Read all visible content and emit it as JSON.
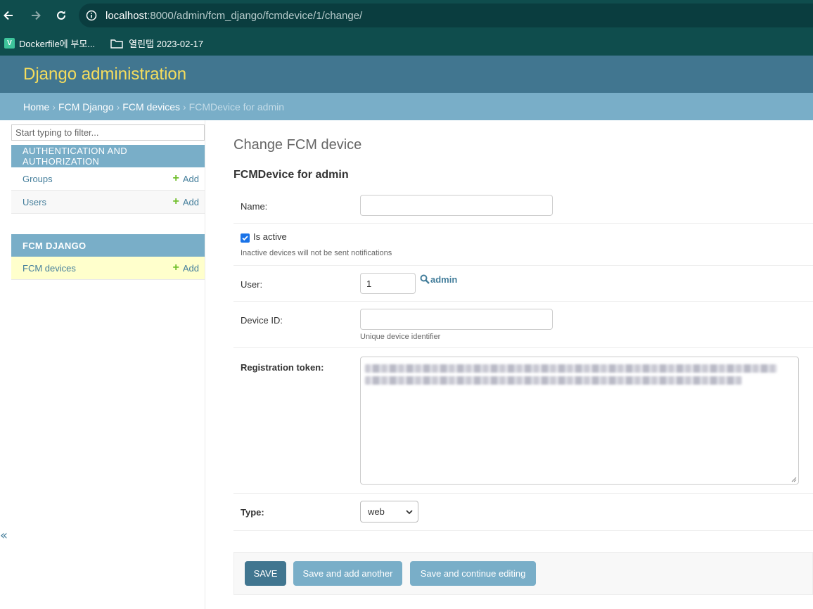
{
  "browser": {
    "url_host": "localhost",
    "url_path": ":8000/admin/fcm_django/fcmdevice/1/change/",
    "bookmarks": [
      {
        "label": "Dockerfile에 부모...",
        "icon": "v-site-icon"
      },
      {
        "label": "열린탭 2023-02-17",
        "icon": "folder-icon"
      }
    ]
  },
  "header": {
    "brand": "Django administration"
  },
  "breadcrumbs": {
    "items": [
      "Home",
      "FCM Django",
      "FCM devices"
    ],
    "separator": "›",
    "current": "FCMDevice for admin"
  },
  "sidebar": {
    "filter_placeholder": "Start typing to filter...",
    "modules": [
      {
        "caption": "AUTHENTICATION AND AUTHORIZATION",
        "models": [
          {
            "name": "Groups",
            "add": "Add"
          },
          {
            "name": "Users",
            "add": "Add"
          }
        ]
      },
      {
        "caption": "FCM DJANGO",
        "models": [
          {
            "name": "FCM devices",
            "add": "Add"
          }
        ]
      }
    ],
    "collapse_label": "«"
  },
  "content": {
    "page_title": "Change FCM device",
    "object_title": "FCMDevice for admin",
    "fields": {
      "name": {
        "label": "Name:",
        "value": ""
      },
      "is_active": {
        "label": "Is active",
        "checked": true,
        "help": "Inactive devices will not be sent notifications"
      },
      "user": {
        "label": "User:",
        "value": "1",
        "lookup_name": "admin"
      },
      "device_id": {
        "label": "Device ID:",
        "value": "",
        "help": "Unique device identifier"
      },
      "registration_token": {
        "label": "Registration token:"
      },
      "type": {
        "label": "Type:",
        "selected": "web"
      }
    },
    "buttons": {
      "save": "SAVE",
      "save_add_another": "Save and add another",
      "save_continue": "Save and continue editing"
    }
  },
  "colors": {
    "header": "#417690",
    "breadcrumbs": "#79aec8",
    "brand": "#f5dd5d",
    "link": "#447e9b",
    "add_plus": "#70bf2b",
    "current_model_bg": "#ffffcc"
  }
}
